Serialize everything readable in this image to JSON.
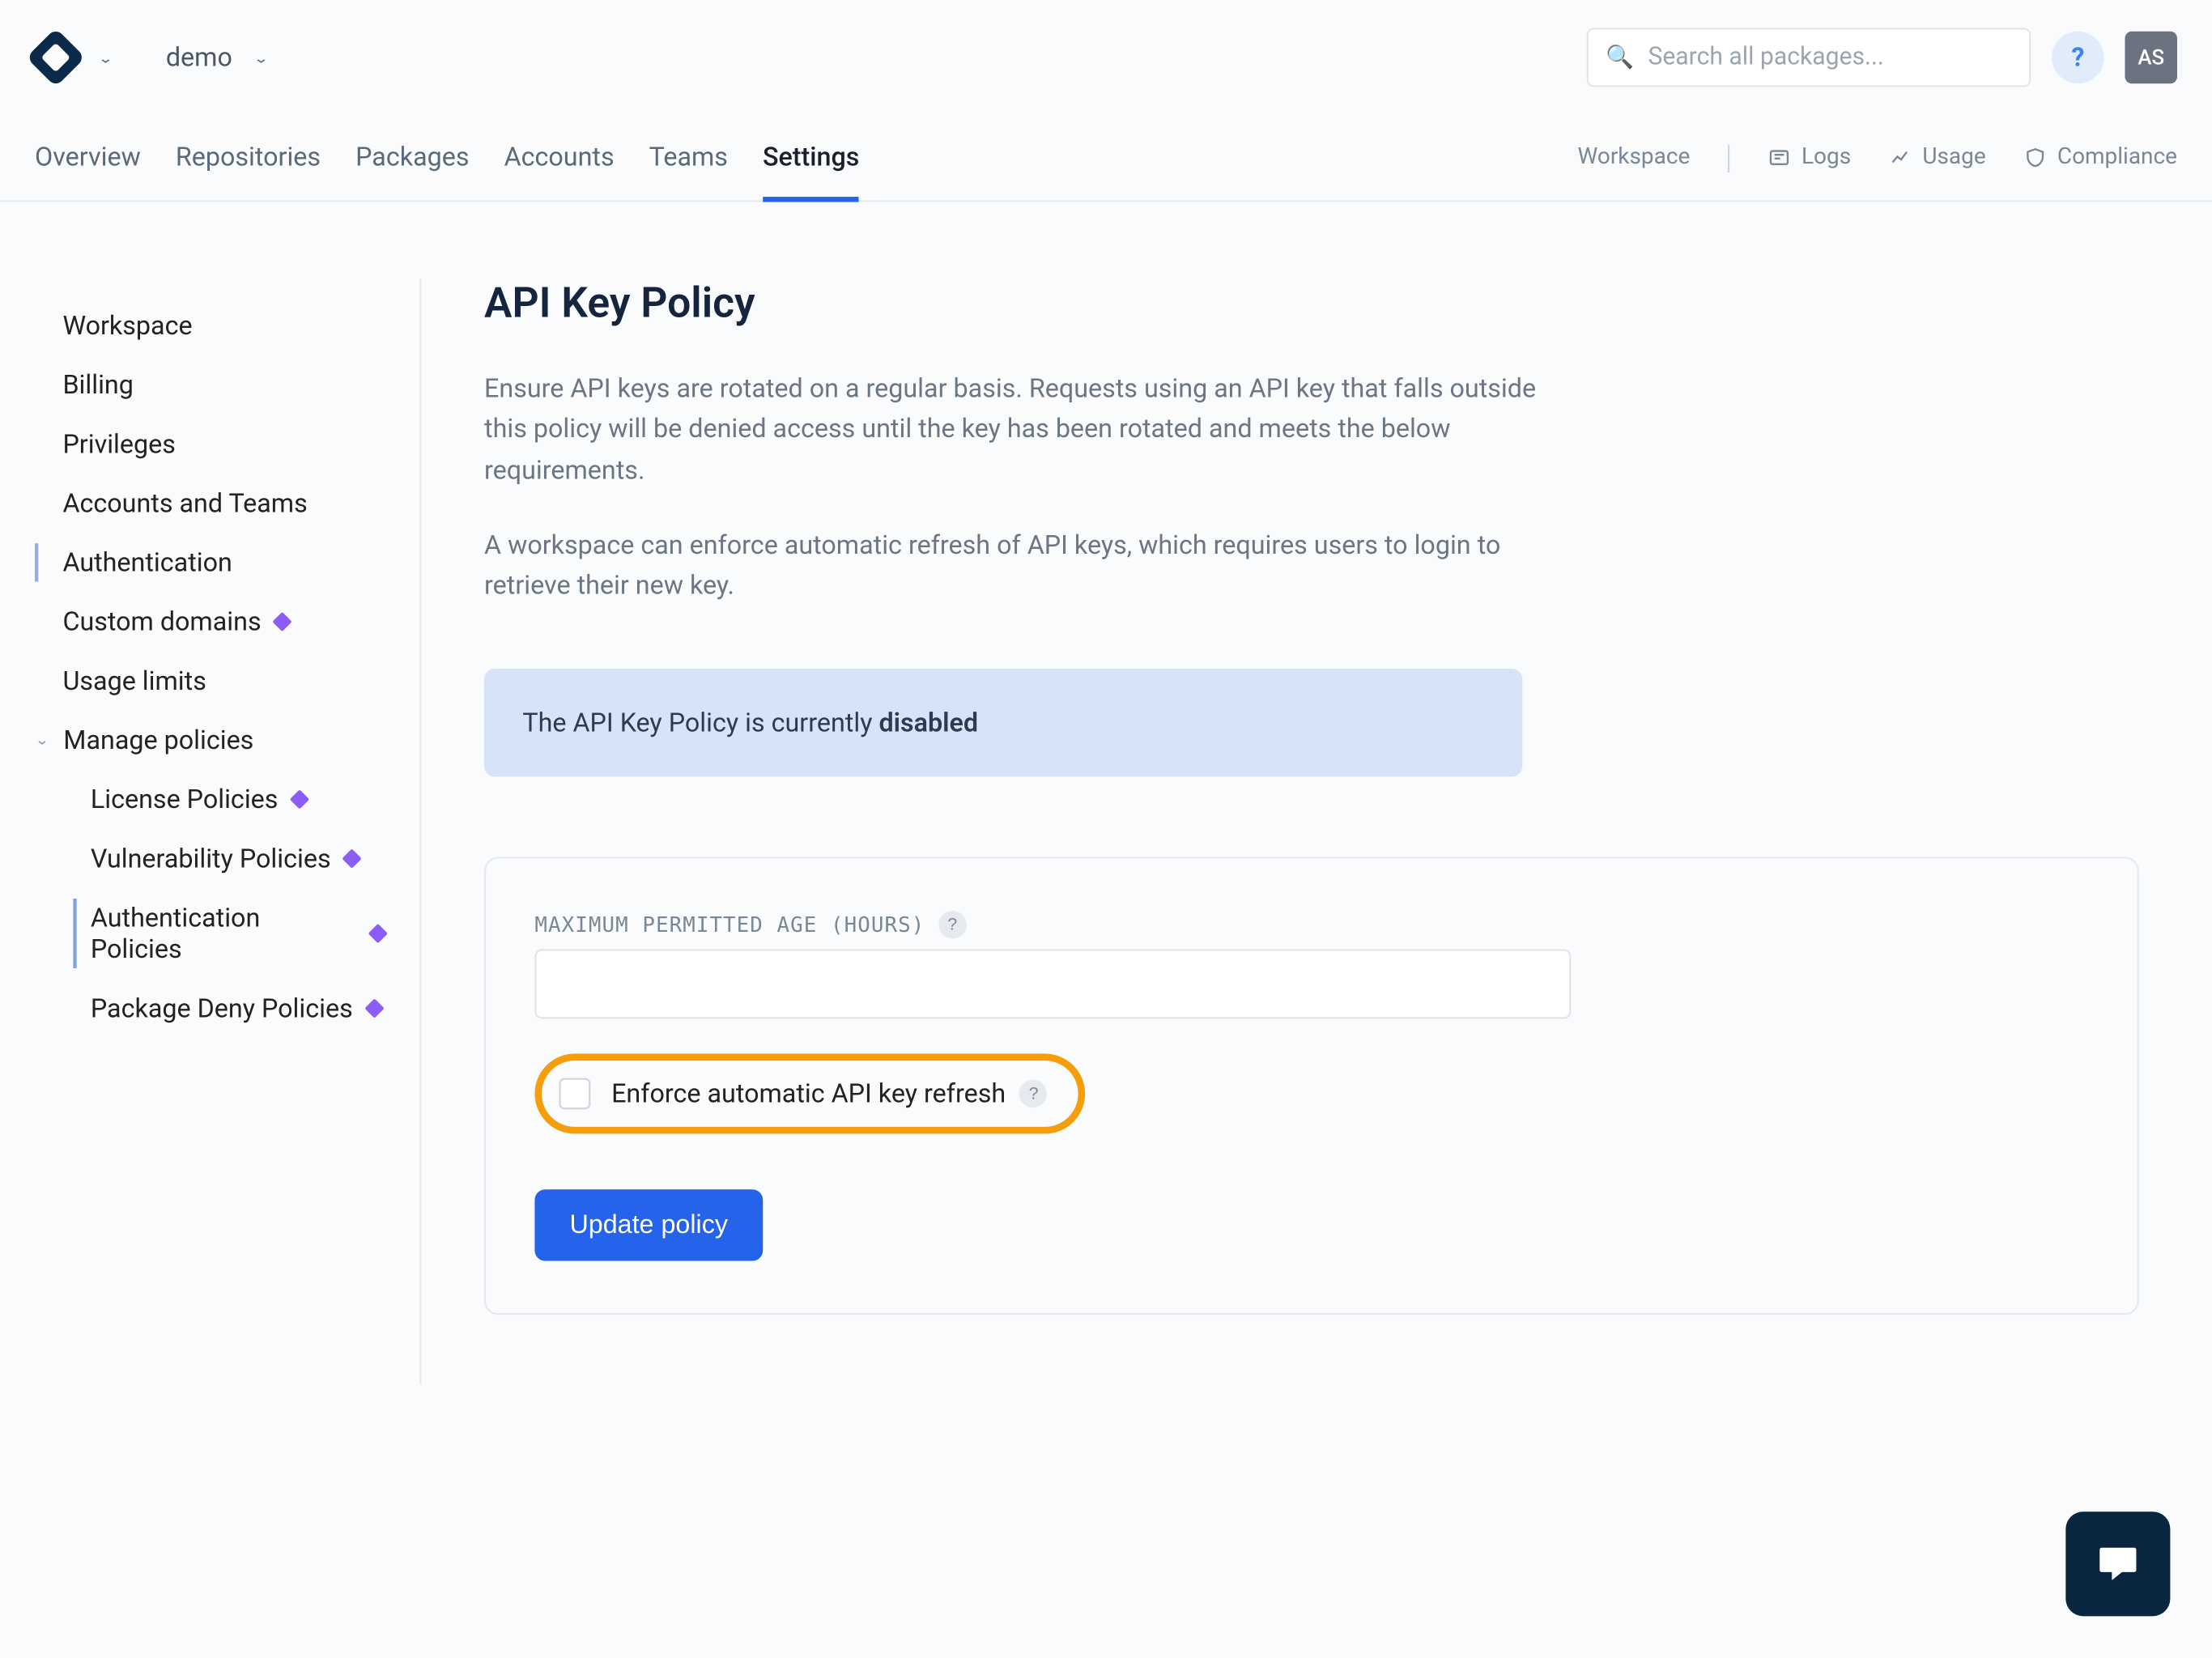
{
  "header": {
    "workspace": "demo",
    "search_placeholder": "Search all packages...",
    "avatar": "AS"
  },
  "nav": {
    "items": [
      {
        "label": "Overview"
      },
      {
        "label": "Repositories"
      },
      {
        "label": "Packages"
      },
      {
        "label": "Accounts"
      },
      {
        "label": "Teams"
      },
      {
        "label": "Settings"
      }
    ],
    "right": {
      "workspace_label": "Workspace",
      "logs": "Logs",
      "usage": "Usage",
      "compliance": "Compliance"
    }
  },
  "sidebar": {
    "items": [
      {
        "label": "Workspace"
      },
      {
        "label": "Billing"
      },
      {
        "label": "Privileges"
      },
      {
        "label": "Accounts and Teams"
      },
      {
        "label": "Authentication"
      },
      {
        "label": "Custom domains"
      },
      {
        "label": "Usage limits"
      },
      {
        "label": "Manage policies"
      }
    ],
    "policies": [
      {
        "label": "License Policies"
      },
      {
        "label": "Vulnerability Policies"
      },
      {
        "label": "Authentication Policies"
      },
      {
        "label": "Package Deny Policies"
      }
    ]
  },
  "page": {
    "title": "API Key Policy",
    "desc1": "Ensure API keys are rotated on a regular basis. Requests using an API key that falls outside this policy will be denied access until the key has been rotated and meets the below requirements.",
    "desc2": "A workspace can enforce automatic refresh of API keys, which requires users to login to retrieve their new key.",
    "alert_prefix": "The API Key Policy is currently ",
    "alert_status": "disabled",
    "field_label": "MAXIMUM PERMITTED AGE (HOURS)",
    "checkbox_label": "Enforce automatic API key refresh",
    "button_label": "Update policy"
  }
}
